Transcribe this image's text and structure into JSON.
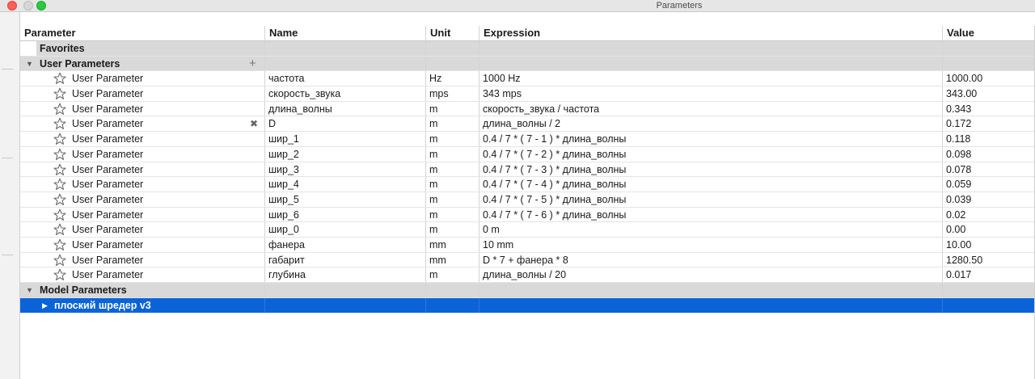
{
  "window": {
    "title": "Parameters"
  },
  "columns": {
    "parameter": "Parameter",
    "name": "Name",
    "unit": "Unit",
    "expression": "Expression",
    "value": "Value"
  },
  "groups": {
    "favorites": "Favorites",
    "user": "User Parameters",
    "model": "Model Parameters"
  },
  "add_icon": "plus-icon",
  "rows": [
    {
      "label": "User Parameter",
      "name": "частота",
      "unit": "Hz",
      "expression": "1000 Hz",
      "value": "1000.00"
    },
    {
      "label": "User Parameter",
      "name": "скорость_звука",
      "unit": "mps",
      "expression": "343 mps",
      "value": "343.00"
    },
    {
      "label": "User Parameter",
      "name": "длина_волны",
      "unit": "m",
      "expression": "скорость_звука / частота",
      "value": "0.343"
    },
    {
      "label": "User Parameter",
      "name": "D",
      "unit": "m",
      "expression": "длина_волны / 2",
      "value": "0.172"
    },
    {
      "label": "User Parameter",
      "name": "шир_1",
      "unit": "m",
      "expression": "0.4 / 7 * ( 7 - 1 ) * длина_волны",
      "value": "0.118"
    },
    {
      "label": "User Parameter",
      "name": "шир_2",
      "unit": "m",
      "expression": "0.4 / 7 * ( 7 - 2 ) * длина_волны",
      "value": "0.098"
    },
    {
      "label": "User Parameter",
      "name": "шир_3",
      "unit": "m",
      "expression": "0.4 / 7 * ( 7 - 3 ) * длина_волны",
      "value": "0.078"
    },
    {
      "label": "User Parameter",
      "name": "шир_4",
      "unit": "m",
      "expression": "0.4 / 7 * ( 7 - 4 ) * длина_волны",
      "value": "0.059"
    },
    {
      "label": "User Parameter",
      "name": "шир_5",
      "unit": "m",
      "expression": "0.4 / 7 * ( 7 - 5 ) * длина_волны",
      "value": "0.039"
    },
    {
      "label": "User Parameter",
      "name": "шир_6",
      "unit": "m",
      "expression": "0.4 / 7 * ( 7 - 6 ) * длина_волны",
      "value": "0.02"
    },
    {
      "label": "User Parameter",
      "name": "шир_0",
      "unit": "m",
      "expression": "0 m",
      "value": "0.00"
    },
    {
      "label": "User Parameter",
      "name": "фанера",
      "unit": "mm",
      "expression": "10 mm",
      "value": "10.00"
    },
    {
      "label": "User Parameter",
      "name": "габарит",
      "unit": "mm",
      "expression": "D * 7 + фанера * 8",
      "value": "1280.50"
    },
    {
      "label": "User Parameter",
      "name": "глубина",
      "unit": "m",
      "expression": "длина_волны / 20",
      "value": "0.017"
    }
  ],
  "model_item": {
    "label": "плоский шредер v3"
  },
  "colors": {
    "selection": "#0a64d8",
    "group_bg": "#d9d9d9"
  }
}
